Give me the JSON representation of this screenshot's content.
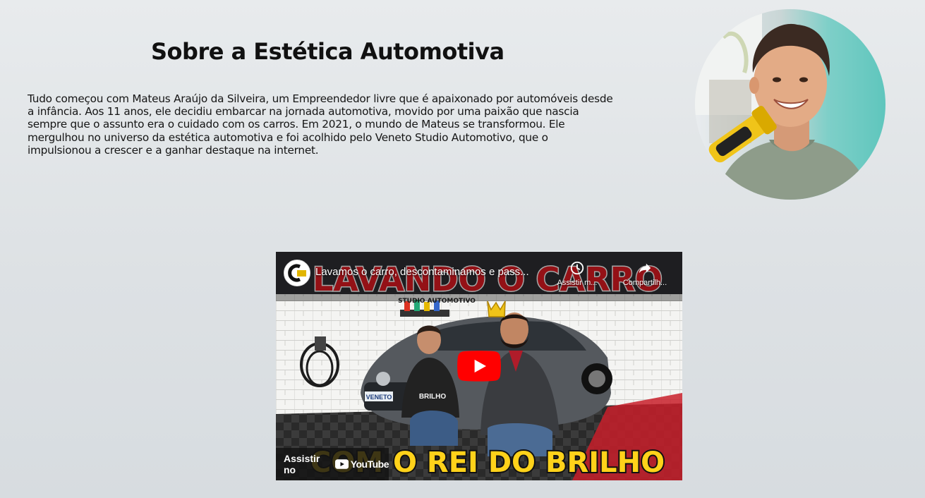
{
  "about": {
    "title": "Sobre a Estética Automotiva",
    "text": "Tudo começou com Mateus Araújo da Silveira, um Empreendedor livre que é apaixonado por automóveis desde a infância. Aos 11 anos, ele decidiu embarcar na jornada automotiva, movido por uma paixão que nascia sempre que o assunto era o cuidado com os carros. Em 2021, o mundo de Mateus se transformou. Ele mergulhou no universo da estética automotiva e foi acolhido pelo Veneto Studio Automotivo, que o impulsionou a crescer e a ganhar destaque na internet."
  },
  "video": {
    "title": "Lavamos o carro, descontaminamos e pass...",
    "watch_later": "Assistir m...",
    "share": "Compartilh...",
    "watch_on": "Assistir no",
    "youtube_word": "YouTube",
    "thumb_headline_top": "LAVANDO O CARRO",
    "thumb_headline_bottom": "COM O REI DO BRILHO",
    "thumb_wall_sign": "STUDIO AUTOMOTIVO",
    "thumb_plate": "VENETO",
    "thumb_shirt": "BRILHO"
  },
  "colors": {
    "youtube_red": "#ff0000",
    "headline_red": "#e31b23",
    "headline_yellow": "#ffd21a"
  }
}
